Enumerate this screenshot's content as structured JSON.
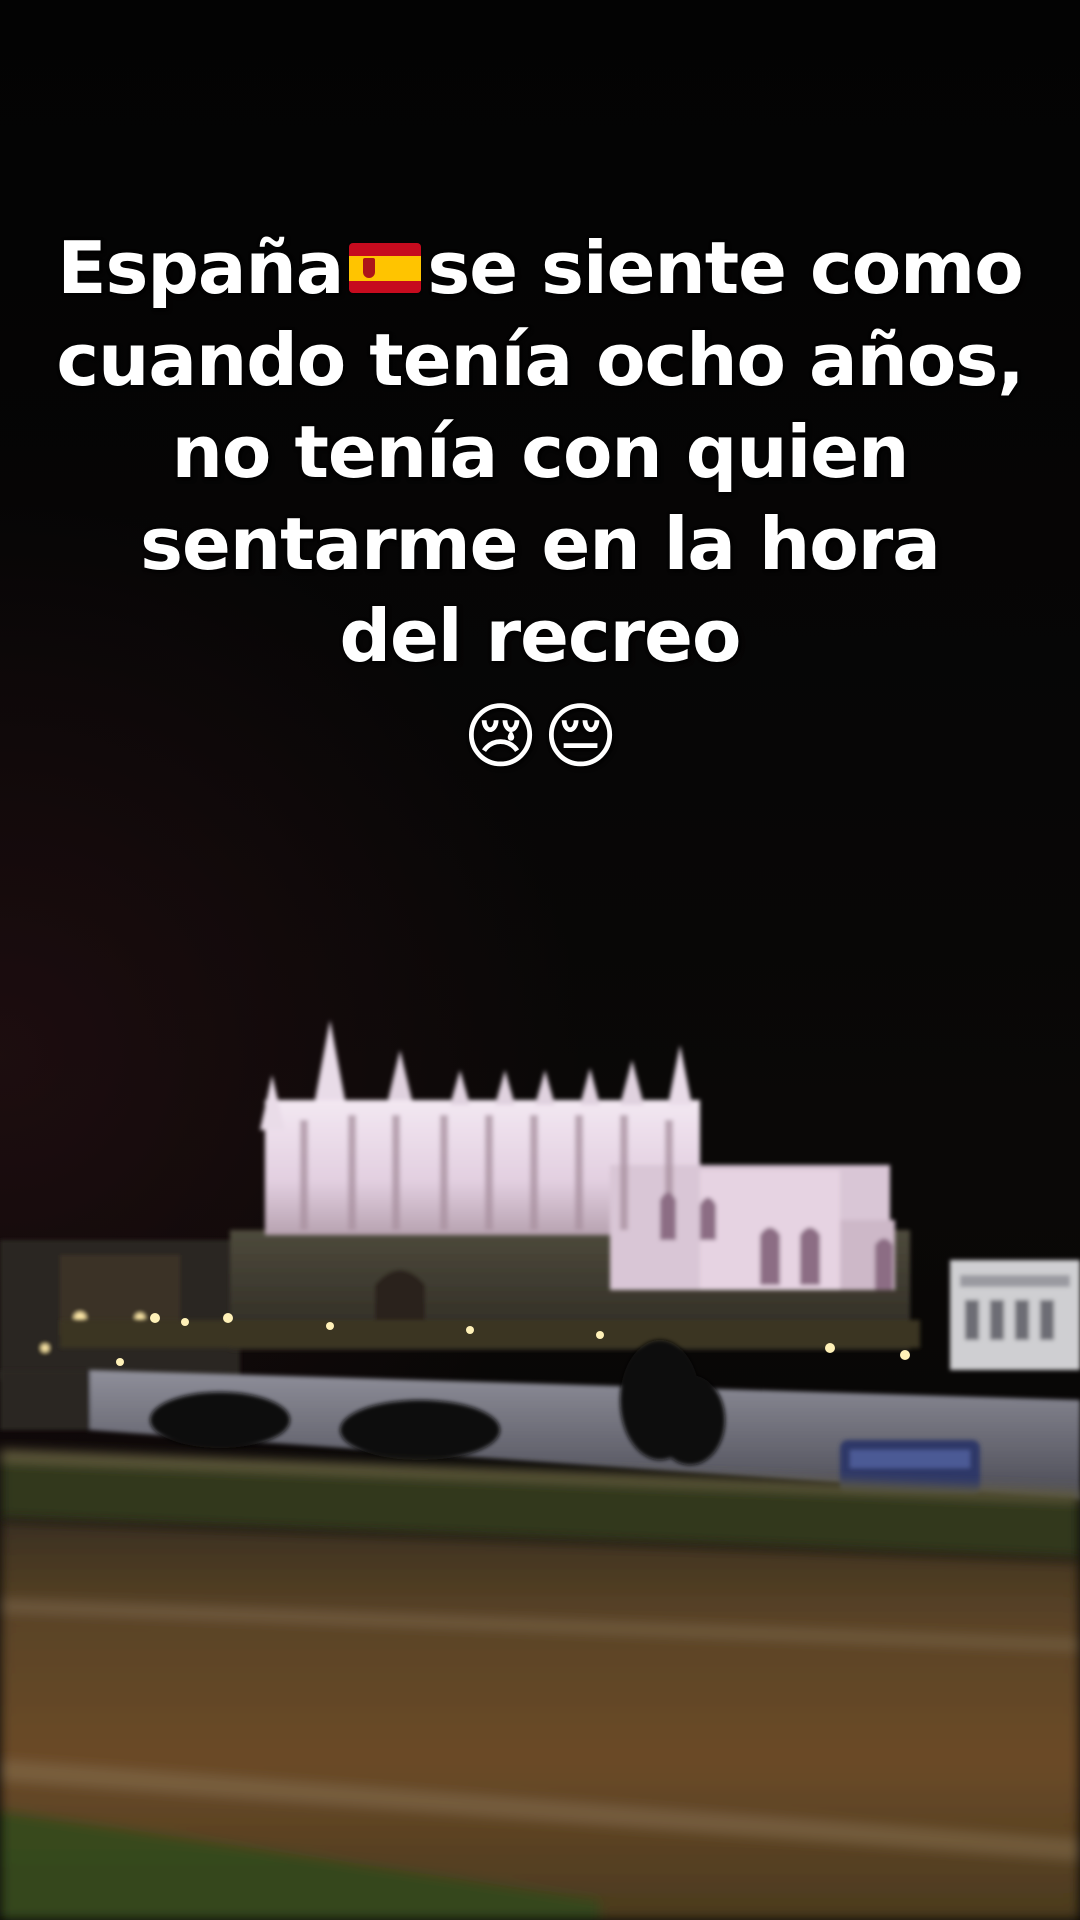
{
  "caption": {
    "line1_before_flag": "España",
    "line1_after_flag": "se siente como",
    "line2": "cuando tenía ocho años,",
    "line3": "no tenía con quien",
    "line4": "sentarme en la hora",
    "line5": "del recreo",
    "emoji1": "😢",
    "emoji2": "😔",
    "flag_icon": "spain-flag-icon"
  },
  "colors": {
    "background": "#050404",
    "text": "#ffffff",
    "cathedral_light": "#efe3ee",
    "road": "#5a4023"
  }
}
